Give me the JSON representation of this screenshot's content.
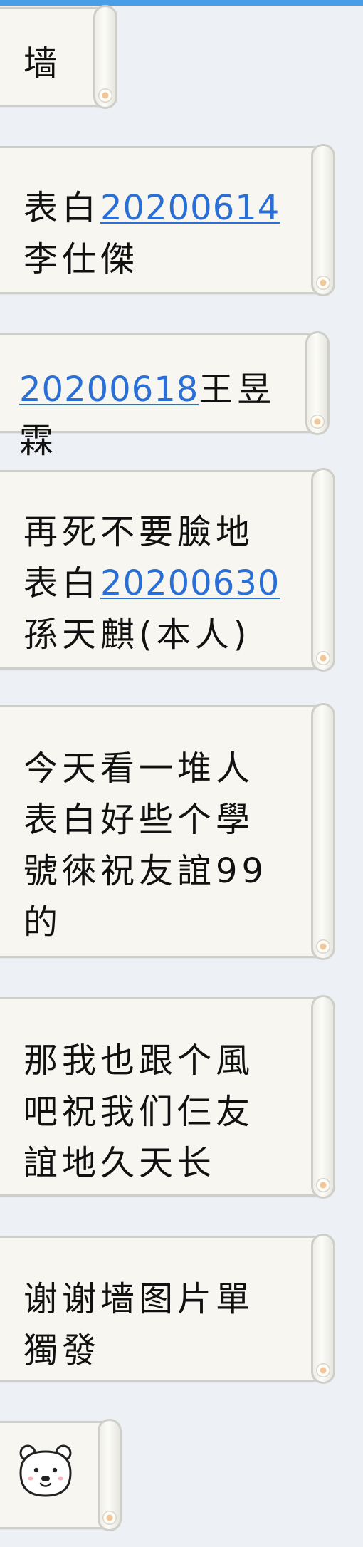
{
  "chat": {
    "messages": [
      {
        "segments": [
          {
            "t": "墙"
          }
        ]
      },
      {
        "segments": [
          {
            "t": "表白"
          },
          {
            "t": "20200614",
            "link": true
          },
          {
            "t": "李仕傑"
          }
        ]
      },
      {
        "segments": [
          {
            "t": "20200618",
            "link": true
          },
          {
            "t": "王昱霖"
          }
        ]
      },
      {
        "segments": [
          {
            "t": "再死不要臉地表白"
          },
          {
            "t": "20200630",
            "link": true
          },
          {
            "t": "孫天麒(本人)"
          }
        ]
      },
      {
        "segments": [
          {
            "t": "今天看一堆人表白好些个學號徠祝友誼99的"
          }
        ]
      },
      {
        "segments": [
          {
            "t": "那我也跟个風吧祝我们仨友誼地久天长"
          }
        ]
      },
      {
        "segments": [
          {
            "t": "谢谢墙图片單獨發"
          }
        ]
      }
    ],
    "sticker": {
      "icon": "polar-bear-sticker-icon"
    }
  },
  "colors": {
    "bubble_bg": "#f7f6f1",
    "link": "#2a6fd6",
    "page_bg": "#edf0f4",
    "top_bar": "#4a9ee8"
  }
}
